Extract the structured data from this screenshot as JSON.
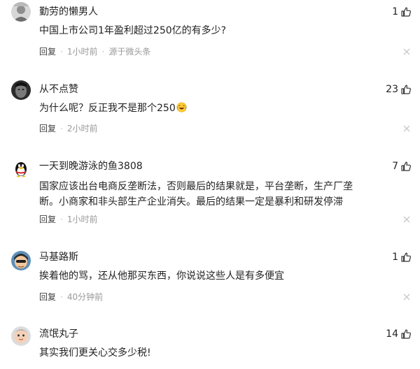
{
  "comments": [
    {
      "username": "勤劳的懒男人",
      "likes": "1",
      "text": "中国上市公司1年盈利超过250亿的有多少?",
      "reply_label": "回复",
      "time": "1小时前",
      "source": "源于微头条"
    },
    {
      "username": "从不点赞",
      "likes": "23",
      "text": "为什么呢？反正我不是那个250",
      "reply_label": "回复",
      "time": "2小时前"
    },
    {
      "username": "一天到晚游泳的鱼3808",
      "likes": "7",
      "text": "国家应该出台电商反垄断法，否则最后的结果就是，平台垄断，生产厂垄断。小商家和非头部生产企业消失。最后的结果一定是暴利和研发停滞",
      "reply_label": "回复",
      "time": "1小时前"
    },
    {
      "username": "马基路斯",
      "likes": "1",
      "text": "挨着他的骂，还从他那买东西，你说说这些人是有多便宜",
      "reply_label": "回复",
      "time": "40分钟前"
    },
    {
      "username": "流氓丸子",
      "likes": "14",
      "text": "其实我们更关心交多少税!"
    }
  ],
  "icons": {
    "like": "thumbs-up-outline-icon",
    "close": "close-x-icon",
    "emoji": "laughing-tears-emoji"
  },
  "colors": {
    "text": "#222222",
    "meta": "#999999",
    "close": "#c8c8c8"
  }
}
